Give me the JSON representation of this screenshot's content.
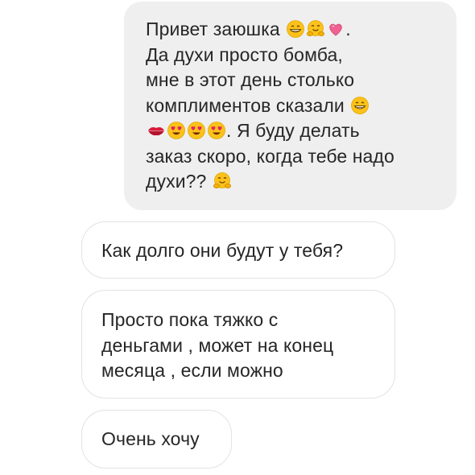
{
  "conversation": {
    "outgoing": {
      "line1": "Привет заюшка",
      "line1_end": ".",
      "line2": "Да духи просто бомба,",
      "line3": "мне в этот день столько",
      "line4": "комплиментов сказали",
      "line5": ". Я буду делать",
      "line6": "заказ скоро, когда тебе надо",
      "line7": "духи??"
    },
    "incoming": [
      {
        "lines": [
          "Как долго они будут у тебя?"
        ]
      },
      {
        "lines": [
          "Просто пока тяжко с",
          "деньгами , может на конец",
          "месяца , если можно"
        ]
      },
      {
        "lines": [
          "Очень хочу"
        ]
      }
    ]
  },
  "emoji": {
    "line1": [
      "grinning-face-icon",
      "hugging-face-icon",
      "sparkling-heart-icon"
    ],
    "line4": [
      "grinning-face-icon"
    ],
    "line5": [
      "kiss-mark-icon",
      "heart-eyes-icon",
      "heart-eyes-icon",
      "heart-eyes-icon"
    ],
    "line7": [
      "hugging-face-icon"
    ]
  },
  "colors": {
    "outgoing_bubble": "#efefef",
    "incoming_border": "#e3e3e3",
    "text": "#262626",
    "emoji_yellow": "#fcc21b",
    "heart_pink": "#f06292",
    "lips_red": "#d81b3a"
  }
}
